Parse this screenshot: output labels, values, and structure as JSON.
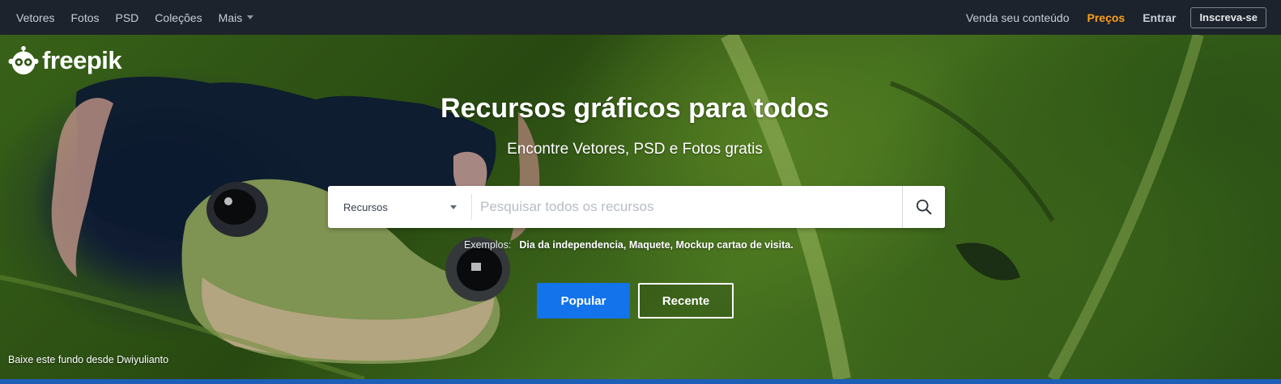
{
  "nav": {
    "left": [
      {
        "label": "Vetores"
      },
      {
        "label": "Fotos"
      },
      {
        "label": "PSD"
      },
      {
        "label": "Coleções"
      },
      {
        "label": "Mais"
      }
    ],
    "right": {
      "sell": "Venda seu conteúdo",
      "pricing": "Preços",
      "login": "Entrar",
      "signup": "Inscreva-se"
    }
  },
  "brand": {
    "name": "freepik"
  },
  "hero": {
    "title": "Recursos gráficos para todos",
    "subtitle": "Encontre Vetores, PSD e Fotos gratis"
  },
  "search": {
    "category": "Recursos",
    "placeholder": "Pesquisar todos os recursos",
    "button_icon": "search-icon"
  },
  "examples": {
    "label": "Exemplos:",
    "items": [
      "Dia da independencia,",
      "Maquete,",
      "Mockup cartao de visita."
    ]
  },
  "buttons": {
    "popular": "Popular",
    "recent": "Recente"
  },
  "credit": "Baixe este fundo desde Dwiyulianto",
  "colors": {
    "topbar": "#1d232c",
    "accent_orange": "#ff9f1c",
    "primary_blue": "#1273eb"
  }
}
